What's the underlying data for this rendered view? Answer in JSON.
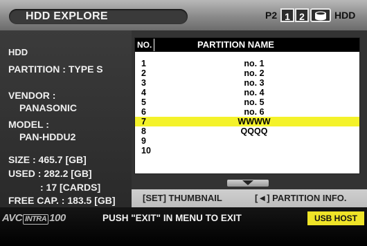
{
  "header": {
    "title": "HDD EXPLORE",
    "p2_label": "P2",
    "slot1_label": "1",
    "slot2_label": "2",
    "disk_icon": "hdd-disk-icon",
    "hdd_label": "HDD"
  },
  "info": {
    "device": "HDD",
    "partition": "PARTITION : TYPE S",
    "vendor_label": "VENDOR :",
    "vendor_value": "PANASONIC",
    "model_label": "MODEL :",
    "model_value": "PAN-HDDU2",
    "size": "SIZE : 465.7 [GB]",
    "used": "USED : 282.2 [GB]",
    "cards": ": 17 [CARDS]",
    "free": "FREE CAP. : 183.5 [GB]"
  },
  "table": {
    "col_no": "NO.",
    "col_name": "PARTITION NAME",
    "rows": [
      {
        "no": "1",
        "name": "no. 1"
      },
      {
        "no": "2",
        "name": "no. 2"
      },
      {
        "no": "3",
        "name": "no. 3"
      },
      {
        "no": "4",
        "name": "no. 4"
      },
      {
        "no": "5",
        "name": "no. 5"
      },
      {
        "no": "6",
        "name": "no. 6"
      },
      {
        "no": "7",
        "name": "WWWW"
      },
      {
        "no": "8",
        "name": "QQQQ"
      },
      {
        "no": "9",
        "name": ""
      },
      {
        "no": "10",
        "name": ""
      }
    ],
    "selected_row": 7
  },
  "buttons": {
    "thumbnail": "[SET] THUMBNAIL",
    "partition_info": "[◄] PARTITION INFO."
  },
  "footer": {
    "avc": "AVC",
    "intra": "INTRA",
    "num": "100",
    "message": "PUSH \"EXIT\" IN MENU TO EXIT",
    "usb": "USB HOST"
  },
  "colors": {
    "highlight": "#f4f22a",
    "usb_badge": "#efe428"
  }
}
